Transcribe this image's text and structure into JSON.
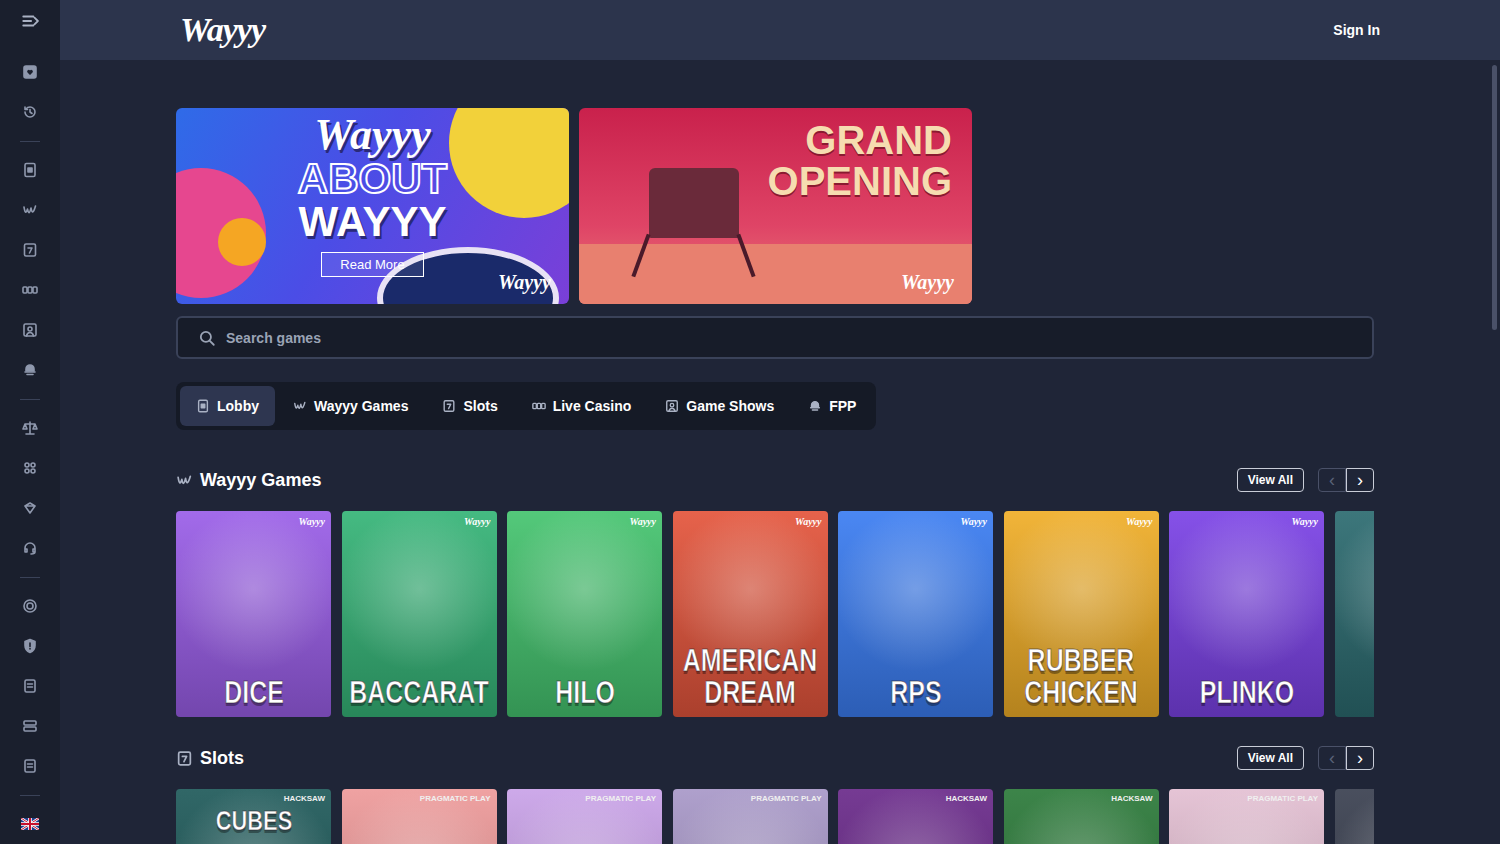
{
  "header": {
    "logo": "Wayyy",
    "sign_in": "Sign In"
  },
  "banners": [
    {
      "kind": "about",
      "script": "Wayyy",
      "title1": "ABOUT",
      "title2": "WAYYY",
      "button": "Read More",
      "mark": "Wayyy"
    },
    {
      "kind": "opening",
      "title1": "GRAND",
      "title2": "OPENING",
      "mark": "Wayyy"
    }
  ],
  "search": {
    "placeholder": "Search games"
  },
  "tabs": [
    {
      "label": "Lobby",
      "selected": true
    },
    {
      "label": "Wayyy Games",
      "selected": false
    },
    {
      "label": "Slots",
      "selected": false
    },
    {
      "label": "Live Casino",
      "selected": false
    },
    {
      "label": "Game Shows",
      "selected": false
    },
    {
      "label": "FPP",
      "selected": false
    }
  ],
  "sections": [
    {
      "kind": "wayyy",
      "title": "Wayyy Games",
      "view_all": "View All",
      "prev": {
        "label": "‹",
        "disabled": true
      },
      "next": {
        "label": "›",
        "disabled": false
      },
      "games": [
        {
          "title": "DICE",
          "badge": "Wayyy",
          "color": "#9a5ee8"
        },
        {
          "title": "BACCARAT",
          "badge": "Wayyy",
          "color": "#35b477"
        },
        {
          "title": "HILO",
          "badge": "Wayyy",
          "color": "#45c46f"
        },
        {
          "title": "AMERICAN DREAM",
          "badge": "Wayyy",
          "color": "#e4553c"
        },
        {
          "title": "RPS",
          "badge": "Wayyy",
          "color": "#3b7df2"
        },
        {
          "title": "RUBBER CHICKEN",
          "badge": "Wayyy",
          "color": "#f0ae28"
        },
        {
          "title": "PLINKO",
          "badge": "Wayyy",
          "color": "#7b42e6"
        },
        {
          "title": "",
          "badge": "",
          "color": "#2c6b70"
        }
      ]
    },
    {
      "kind": "slots",
      "title": "Slots",
      "view_all": "View All",
      "prev": {
        "label": "‹",
        "disabled": true
      },
      "next": {
        "label": "›",
        "disabled": false
      },
      "games": [
        {
          "title": "CUBES",
          "badge": "HACKSAW",
          "color": "#1f5a5a"
        },
        {
          "title": "",
          "badge": "PRAGMATIC PLAY",
          "color": "#ee9a9a"
        },
        {
          "title": "",
          "badge": "PRAGMATIC PLAY",
          "color": "#c9a2e8"
        },
        {
          "title": "",
          "badge": "PRAGMATIC PLAY",
          "color": "#a898c8"
        },
        {
          "title": "",
          "badge": "HACKSAW",
          "color": "#6a2a8a"
        },
        {
          "title": "",
          "badge": "HACKSAW",
          "color": "#2c7a3a"
        },
        {
          "title": "",
          "badge": "PRAGMATIC PLAY",
          "color": "#e3bfd2"
        },
        {
          "title": "",
          "badge": "",
          "color": "#3a4050"
        }
      ]
    }
  ]
}
